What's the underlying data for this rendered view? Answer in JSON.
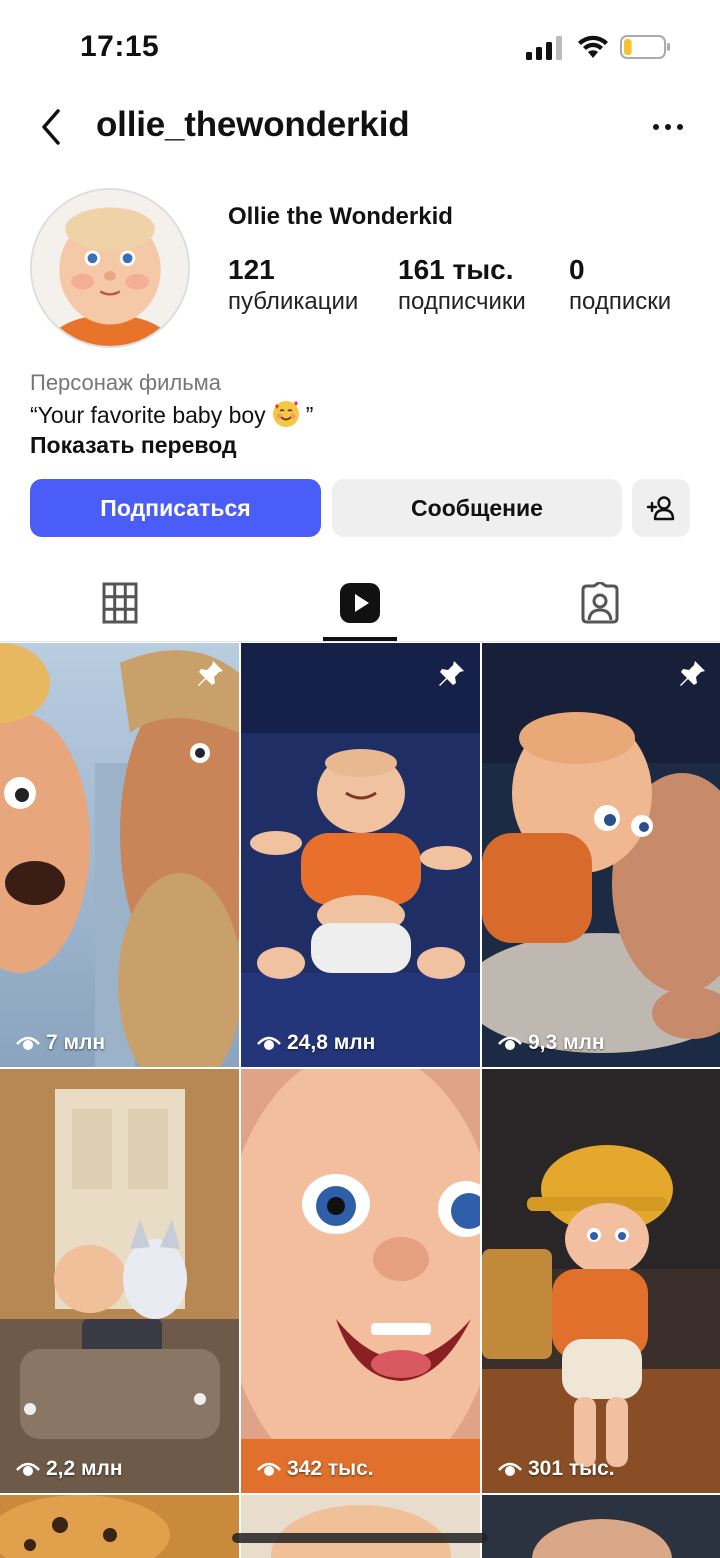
{
  "status_bar": {
    "time": "17:15",
    "battery_level": 0.2
  },
  "header": {
    "username": "ollie_thewonderkid"
  },
  "profile": {
    "display_name": "Ollie the Wonderkid",
    "stats": [
      {
        "value": "121",
        "label": "публикации"
      },
      {
        "value": "161 тыс.",
        "label": "подписчики"
      },
      {
        "value": "0",
        "label": "подписки"
      }
    ],
    "bio_category": "Персонаж фильма",
    "bio_text_start": "“Your favorite baby boy",
    "bio_text_end": "”",
    "bio_emoji": "smiling-face-with-hearts-emoji",
    "translate_label": "Показать перевод"
  },
  "actions": {
    "follow_label": "Подписаться",
    "message_label": "Сообщение",
    "suggest_icon": "add-person-icon",
    "follow_color": "#4a5df9"
  },
  "tabs": [
    {
      "icon": "grid-icon",
      "active": false
    },
    {
      "icon": "reels-icon",
      "active": true
    },
    {
      "icon": "tagged-icon",
      "active": false
    }
  ],
  "reels": [
    {
      "views": "7 млн",
      "pinned": true
    },
    {
      "views": "24,8 млн",
      "pinned": true
    },
    {
      "views": "9,3 млн",
      "pinned": true
    },
    {
      "views": "2,2 млн",
      "pinned": false
    },
    {
      "views": "342 тыс.",
      "pinned": false
    },
    {
      "views": "301 тыс.",
      "pinned": false
    }
  ]
}
